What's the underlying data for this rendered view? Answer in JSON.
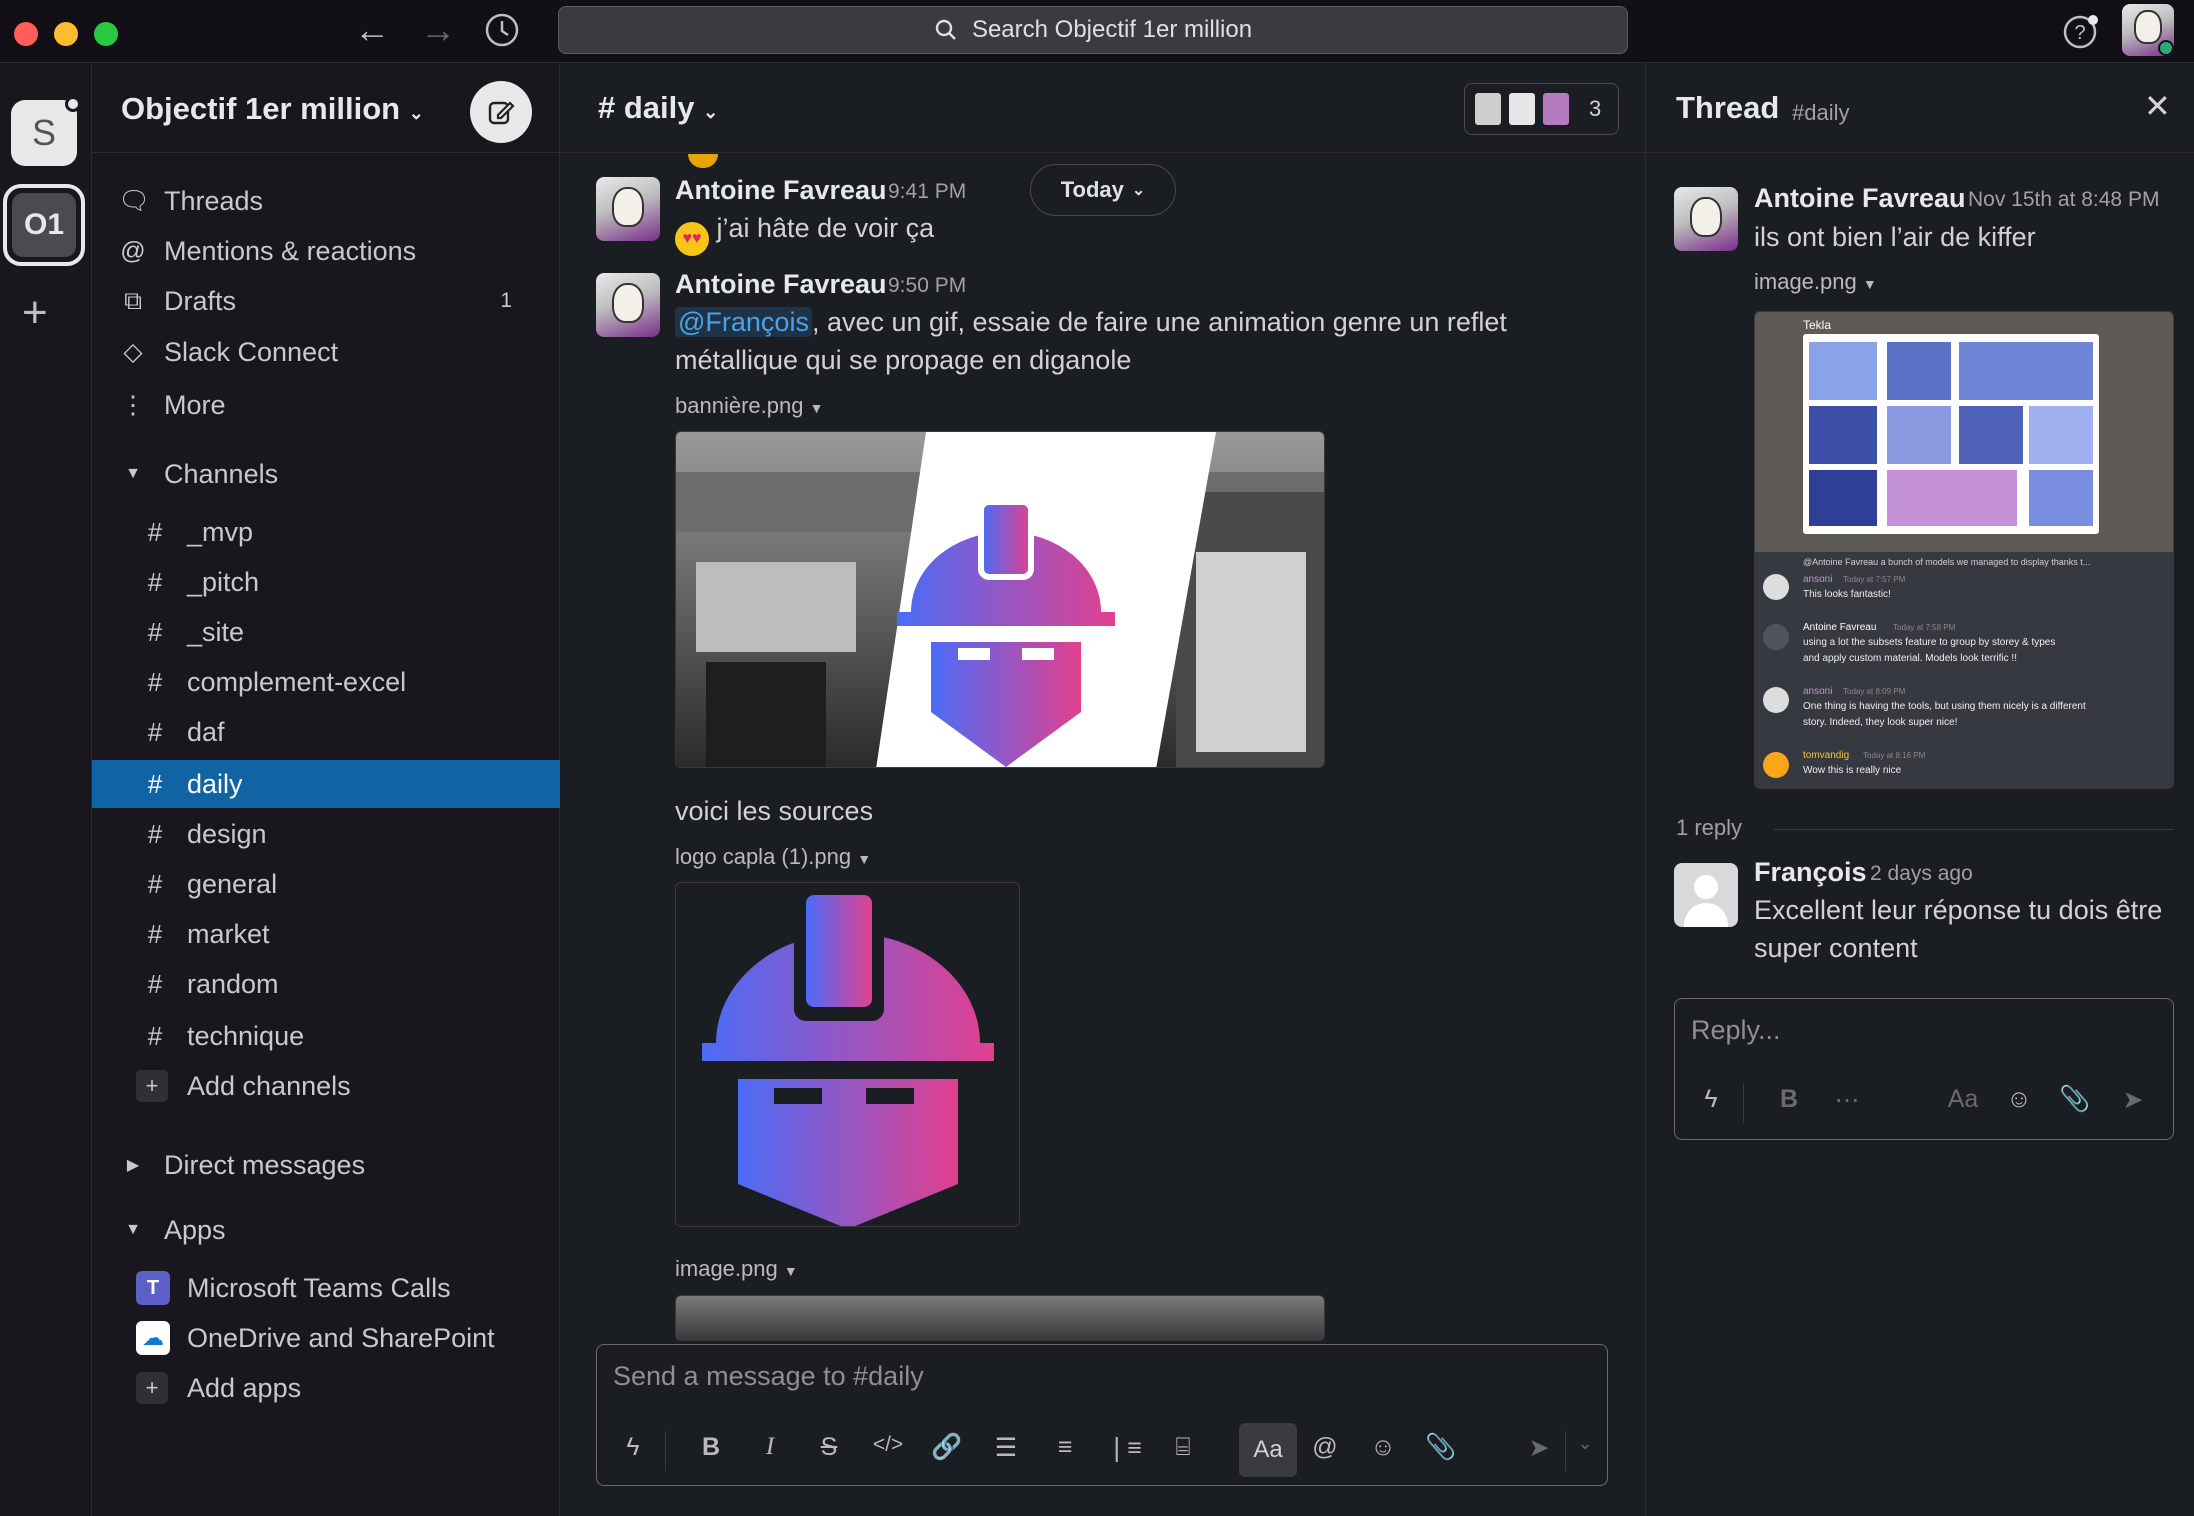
{
  "window": {
    "traffic_lights": [
      "#ff5f57",
      "#febc2e",
      "#28c840"
    ]
  },
  "search": {
    "placeholder": "Search Objectif 1er million"
  },
  "workspaces": [
    {
      "label": "S"
    },
    {
      "label": "O1"
    }
  ],
  "sidebar": {
    "workspace_name": "Objectif 1er million",
    "nav": [
      {
        "label": "Threads",
        "icon": "threads-icon"
      },
      {
        "label": "Mentions & reactions",
        "icon": "at-icon"
      },
      {
        "label": "Drafts",
        "icon": "drafts-icon",
        "count": "1"
      },
      {
        "label": "Slack Connect",
        "icon": "slack-connect-icon"
      },
      {
        "label": "More",
        "icon": "more-icon"
      }
    ],
    "channels_header": "Channels",
    "channels": [
      "_mvp",
      "_pitch",
      "_site",
      "complement-excel",
      "daf",
      "daily",
      "design",
      "general",
      "market",
      "random",
      "technique"
    ],
    "selected_channel": "daily",
    "add_channels": "Add channels",
    "direct_messages_header": "Direct messages",
    "apps_header": "Apps",
    "apps": [
      "Microsoft Teams Calls",
      "OneDrive and SharePoint"
    ],
    "add_apps": "Add apps"
  },
  "main": {
    "channel_title": "# daily",
    "member_count": "3",
    "today_label": "Today",
    "messages": [
      {
        "author": "Antoine Favreau",
        "time": "9:41 PM",
        "text": "j’ai hâte de voir ça"
      },
      {
        "author": "Antoine Favreau",
        "time": "9:50 PM",
        "mention": "@François",
        "text_line1": ", avec un gif, essaie de faire une animation genre un reflet",
        "text_line2": "métallique qui se propage en diganole"
      }
    ],
    "file1": "bannière.png",
    "sources_text": "voici les sources",
    "file2": "logo capla (1).png",
    "file3": "image.png",
    "composer_placeholder": "Send a message to #daily",
    "format_button": "Aa"
  },
  "thread": {
    "title": "Thread",
    "channel": "#daily",
    "parent": {
      "author": "Antoine Favreau",
      "time": "Nov 15th at 8:48 PM",
      "text": "ils ont bien l’air de kiffer",
      "file": "image.png"
    },
    "screenshot": {
      "header": "Tekla",
      "quoted": "@Antoine Favreau a bunch of models we managed to display thanks t...",
      "comments": [
        {
          "user": "ansoni",
          "time": "Today at 7:57 PM",
          "text": "This looks fantastic!"
        },
        {
          "user": "Antoine Favreau",
          "time": "Today at 7:58 PM",
          "text1": "using a lot the subsets feature to group by storey & types",
          "text2": "and apply custom material. Models look terrific !!"
        },
        {
          "user": "ansoni",
          "time": "Today at 8:09 PM",
          "text1": "One thing is having the tools, but using them nicely is a different",
          "text2": "story. Indeed, they look super nice!"
        },
        {
          "user": "tomvandig",
          "time": "Today at 8:16 PM",
          "text": "Wow this is really nice"
        }
      ]
    },
    "reply_count": "1 reply",
    "reply": {
      "author": "François",
      "time": "2 days ago",
      "text_line1": "Excellent leur réponse tu dois être",
      "text_line2": "super content"
    },
    "reply_placeholder": "Reply...",
    "format_button": "Aa"
  }
}
